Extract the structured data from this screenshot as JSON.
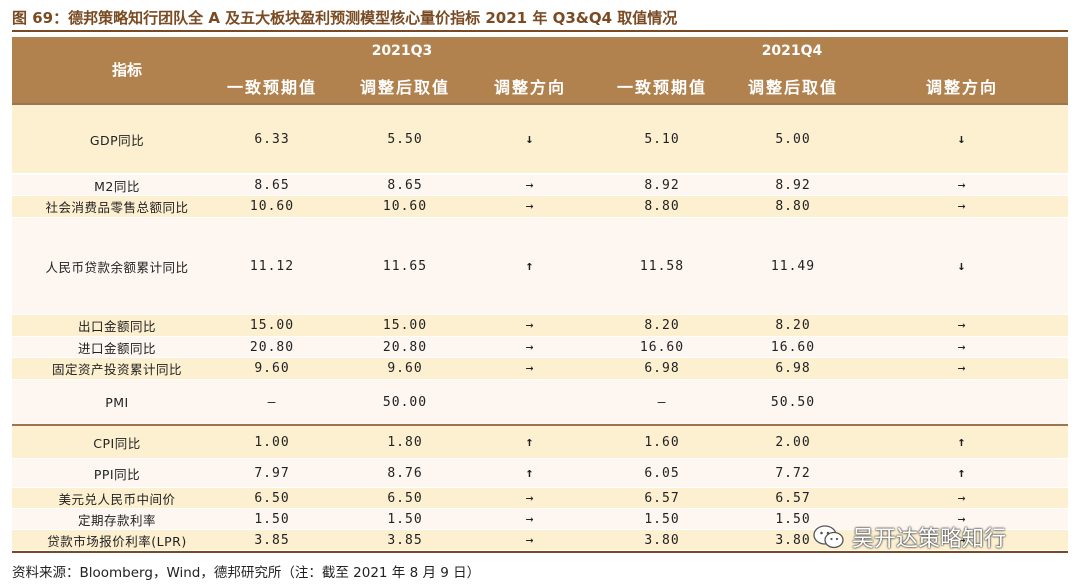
{
  "title": "图 69：德邦策略知行团队全 A 及五大板块盈利预测模型核心量价指标 2021 年 Q3&Q4 取值情况",
  "colors": {
    "header": "#b1824e",
    "band": "#fdf0d0",
    "light": "#fdf6f1",
    "up": "#d62f2f",
    "down": "#7cb342"
  },
  "header": {
    "indicator": "指标",
    "periods": [
      "2021Q3",
      "2021Q4"
    ],
    "columns": [
      "一致预期值",
      "调整后取值",
      "调整方向",
      "一致预期值",
      "调整后取值",
      "调整方向"
    ]
  },
  "rows": [
    {
      "name": "GDP同比",
      "q3_consensus": "6.33",
      "q3_adjusted": "5.50",
      "q3_dir": "↓",
      "q4_consensus": "5.10",
      "q4_adjusted": "5.00",
      "q4_dir": "↓"
    },
    {
      "name": "M2同比",
      "q3_consensus": "8.65",
      "q3_adjusted": "8.65",
      "q3_dir": "→",
      "q4_consensus": "8.92",
      "q4_adjusted": "8.92",
      "q4_dir": "→"
    },
    {
      "name": "社会消费品零售总额同比",
      "q3_consensus": "10.60",
      "q3_adjusted": "10.60",
      "q3_dir": "→",
      "q4_consensus": "8.80",
      "q4_adjusted": "8.80",
      "q4_dir": "→"
    },
    {
      "name": "人民币贷款余额累计同比",
      "q3_consensus": "11.12",
      "q3_adjusted": "11.65",
      "q3_dir": "↑",
      "q4_consensus": "11.58",
      "q4_adjusted": "11.49",
      "q4_dir": "↓"
    },
    {
      "name": "出口金额同比",
      "q3_consensus": "15.00",
      "q3_adjusted": "15.00",
      "q3_dir": "→",
      "q4_consensus": "8.20",
      "q4_adjusted": "8.20",
      "q4_dir": "→"
    },
    {
      "name": "进口金额同比",
      "q3_consensus": "20.80",
      "q3_adjusted": "20.80",
      "q3_dir": "→",
      "q4_consensus": "16.60",
      "q4_adjusted": "16.60",
      "q4_dir": "→"
    },
    {
      "name": "固定资产投资累计同比",
      "q3_consensus": "9.60",
      "q3_adjusted": "9.60",
      "q3_dir": "→",
      "q4_consensus": "6.98",
      "q4_adjusted": "6.98",
      "q4_dir": "→"
    },
    {
      "name": "PMI",
      "q3_consensus": "–",
      "q3_adjusted": "50.00",
      "q3_dir": "",
      "q4_consensus": "–",
      "q4_adjusted": "50.50",
      "q4_dir": ""
    },
    {
      "name": "CPI同比",
      "q3_consensus": "1.00",
      "q3_adjusted": "1.80",
      "q3_dir": "↑",
      "q4_consensus": "1.60",
      "q4_adjusted": "2.00",
      "q4_dir": "↑"
    },
    {
      "name": "PPI同比",
      "q3_consensus": "7.97",
      "q3_adjusted": "8.76",
      "q3_dir": "↑",
      "q4_consensus": "6.05",
      "q4_adjusted": "7.72",
      "q4_dir": "↑"
    },
    {
      "name": "美元兑人民币中间价",
      "q3_consensus": "6.50",
      "q3_adjusted": "6.50",
      "q3_dir": "→",
      "q4_consensus": "6.57",
      "q4_adjusted": "6.57",
      "q4_dir": "→"
    },
    {
      "name": "定期存款利率",
      "q3_consensus": "1.50",
      "q3_adjusted": "1.50",
      "q3_dir": "→",
      "q4_consensus": "1.50",
      "q4_adjusted": "1.50",
      "q4_dir": "→"
    },
    {
      "name": "贷款市场报价利率(LPR)",
      "q3_consensus": "3.85",
      "q3_adjusted": "3.85",
      "q3_dir": "→",
      "q4_consensus": "3.80",
      "q4_adjusted": "3.80",
      "q4_dir": "→"
    }
  ],
  "source": "资料来源：Bloomberg，Wind，德邦研究所（注：截至 2021 年 8 月 9 日）",
  "watermark": {
    "icon": "wechat-icon",
    "text": "吴开达策略知行"
  }
}
